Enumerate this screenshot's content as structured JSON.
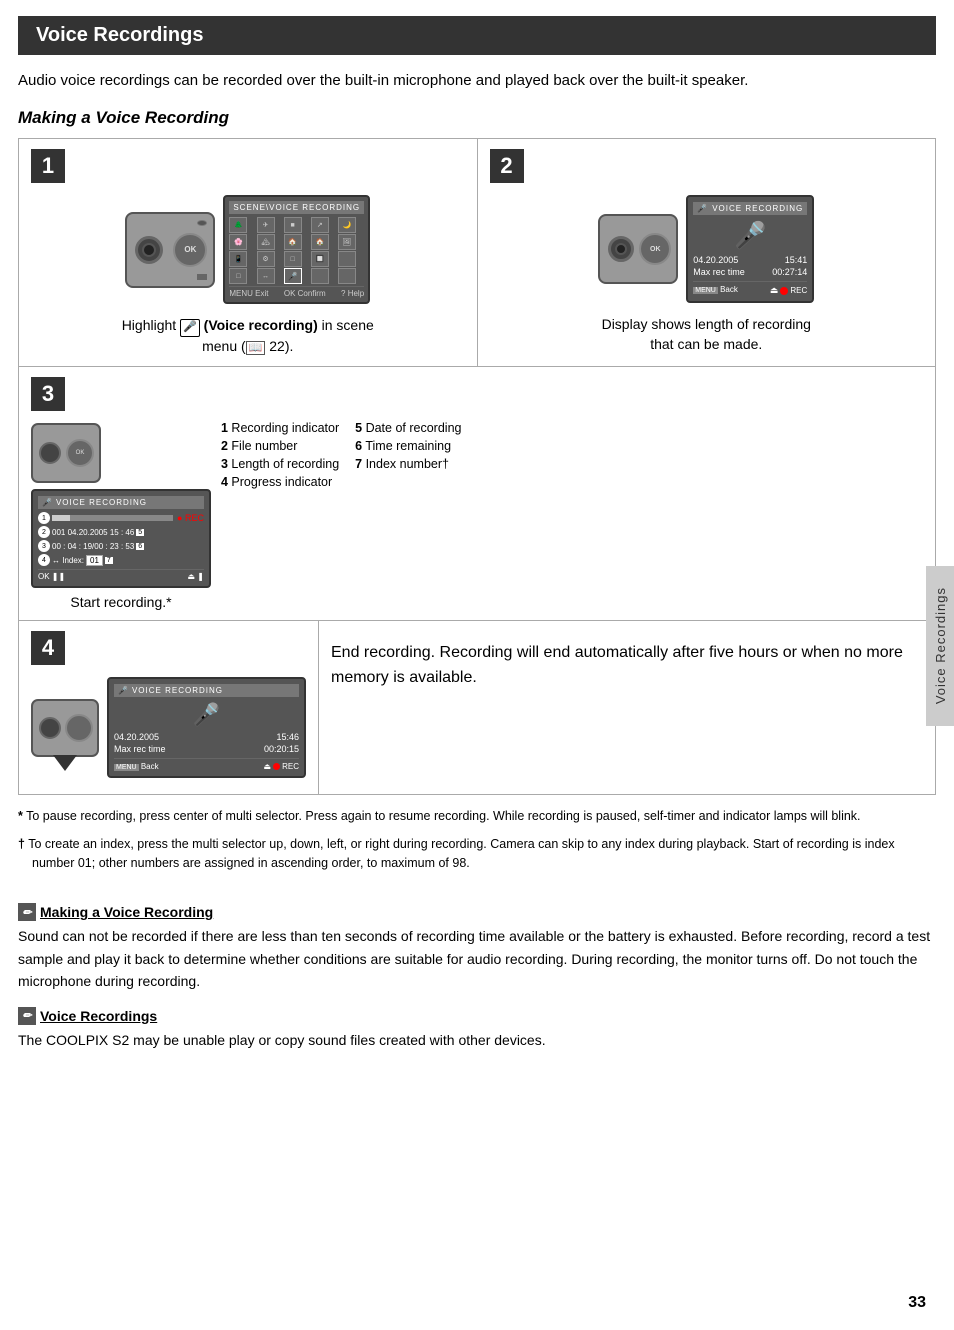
{
  "page": {
    "number": "33",
    "sidebar_label": "Voice Recordings"
  },
  "header": {
    "title": "Voice Recordings"
  },
  "intro": {
    "text": "Audio voice recordings can be recorded over the built-in microphone and played back over the built-it speaker."
  },
  "section1_title": "Making a Voice Recording",
  "steps": [
    {
      "number": "1",
      "caption": "Highlight  (Voice recording) in scene menu ( 22).",
      "display_title": "VOICE RECORDING",
      "scene_tag": "SCENE",
      "bottom_items": [
        "MENU Exit",
        "OK Confirm",
        "? Help"
      ]
    },
    {
      "number": "2",
      "caption": "Display shows length of recording that can be made.",
      "display_title": "VOICE RECORDING",
      "date": "04.20.2005",
      "time": "15:41",
      "max_rec_label": "Max rec time",
      "max_rec_value": "00:27:14",
      "bottom_left": "MENU Back",
      "bottom_right": "REC"
    },
    {
      "number": "3",
      "caption": "Start recording.*",
      "display_title": "VOICE RECORDING",
      "rec_label": "● REC",
      "line1": "001 04.20.2005  15 : 46",
      "line2": "00 : 04 : 19/00 : 23 : 53",
      "line3": "Index: 01",
      "legend": [
        {
          "num": "1",
          "text": "Recording indicator"
        },
        {
          "num": "2",
          "text": "File number"
        },
        {
          "num": "3",
          "text": "Length of recording"
        },
        {
          "num": "4",
          "text": "Progress indicator"
        },
        {
          "num": "5",
          "text": "Date of recording"
        },
        {
          "num": "6",
          "text": "Time remaining"
        },
        {
          "num": "7",
          "text": "Index number†"
        }
      ]
    },
    {
      "number": "4",
      "caption": "",
      "display_title": "VOICE RECORDING",
      "date": "04.20.2005",
      "time": "15:46",
      "max_rec_label": "Max rec time",
      "max_rec_value": "00:20:15",
      "bottom_left": "MENU Back",
      "bottom_right": "REC",
      "end_text": "End recording.  Recording will end automatically after five hours or when no more memory is available."
    }
  ],
  "footnotes": [
    {
      "symbol": "*",
      "text": "To pause recording, press center of multi selector.  Press again to resume recording.  While recording is paused, self-timer and indicator lamps will blink."
    },
    {
      "symbol": "†",
      "text": "To create an index, press the multi selector up, down, left, or right during recording.  Camera can skip to any index during playback.  Start of recording is index number 01; other numbers are assigned in ascending order, to maximum of 98."
    }
  ],
  "notes": [
    {
      "icon": "✏",
      "title": "Making a Voice Recording",
      "text": "Sound can not be recorded if there are less than ten seconds of recording time available or the battery is exhausted.  Before recording, record a test sample and play it back to determine whether conditions are suitable for audio recording.  During recording, the monitor turns off.  Do not touch the microphone during recording."
    },
    {
      "icon": "✏",
      "title": "Voice Recordings",
      "text": "The COOLPIX S2 may be unable play or copy sound files created with other devices."
    }
  ]
}
